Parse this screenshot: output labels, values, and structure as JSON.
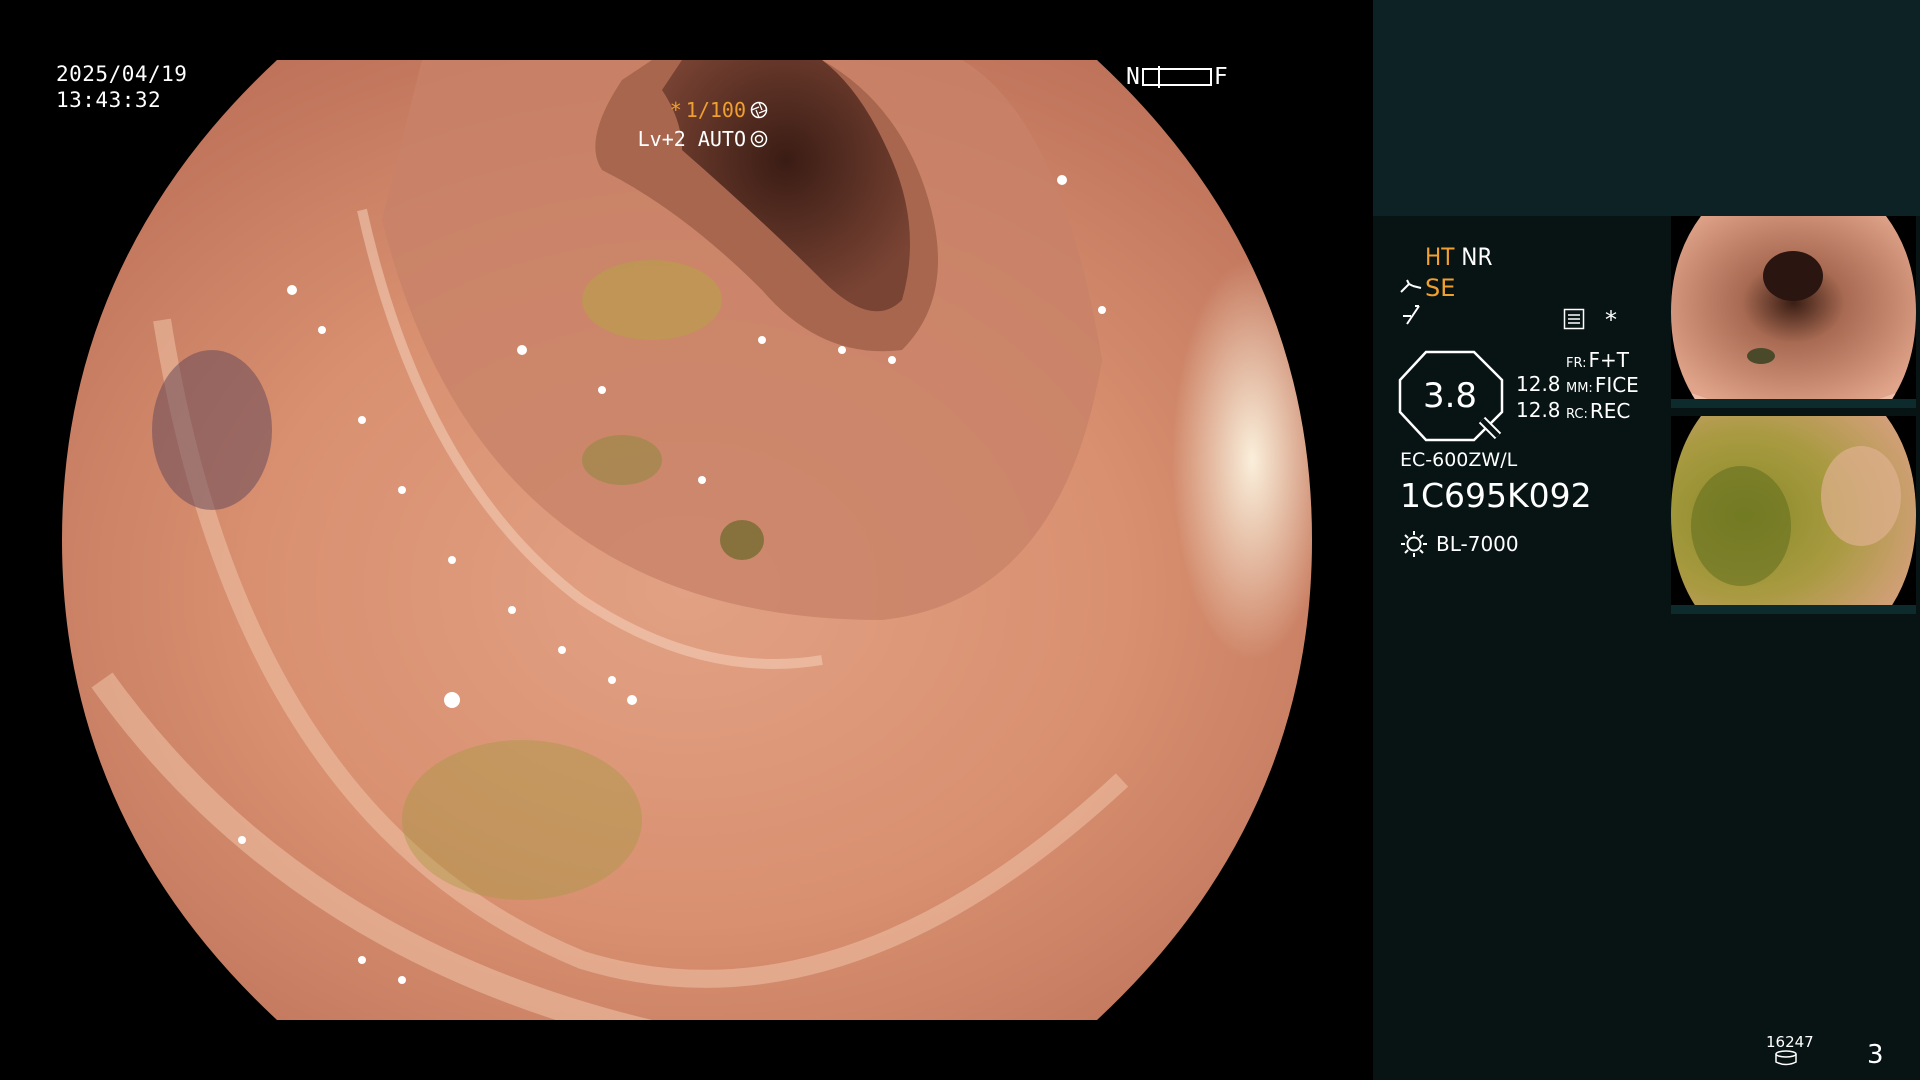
{
  "overlay": {
    "date": "2025/04/19",
    "time": "13:43:32",
    "nf": {
      "near_label": "N",
      "far_label": "F"
    },
    "shutter": "1/100",
    "level": "Lv+2 AUTO"
  },
  "panel": {
    "ht_label": "HT",
    "nr_label": "NR",
    "se_label": "SE",
    "asterisk": "*",
    "zoom": "3.8",
    "values": [
      "12.8",
      "12.8"
    ],
    "params": [
      {
        "key": "FR:",
        "value": "F+T"
      },
      {
        "key": "MM:",
        "value": "FICE"
      },
      {
        "key": "RC:",
        "value": "REC"
      }
    ],
    "scope_model": "EC-600ZW/L",
    "scope_serial": "1C695K092",
    "light_source": "BL-7000",
    "image_count": "16247",
    "page": "3"
  },
  "colors": {
    "accent": "#f0a030",
    "panel_bg": "#081314",
    "panel_top_bg": "#0c2224",
    "text": "#ffffff"
  },
  "icons": {
    "shutter": "iris-icon",
    "level": "gear-icon",
    "se": "tool-icon",
    "flash": "flash-icon",
    "settings": "settings-icon",
    "zoom": "magnifier-icon",
    "light": "sun-icon",
    "counter": "storage-icon"
  }
}
